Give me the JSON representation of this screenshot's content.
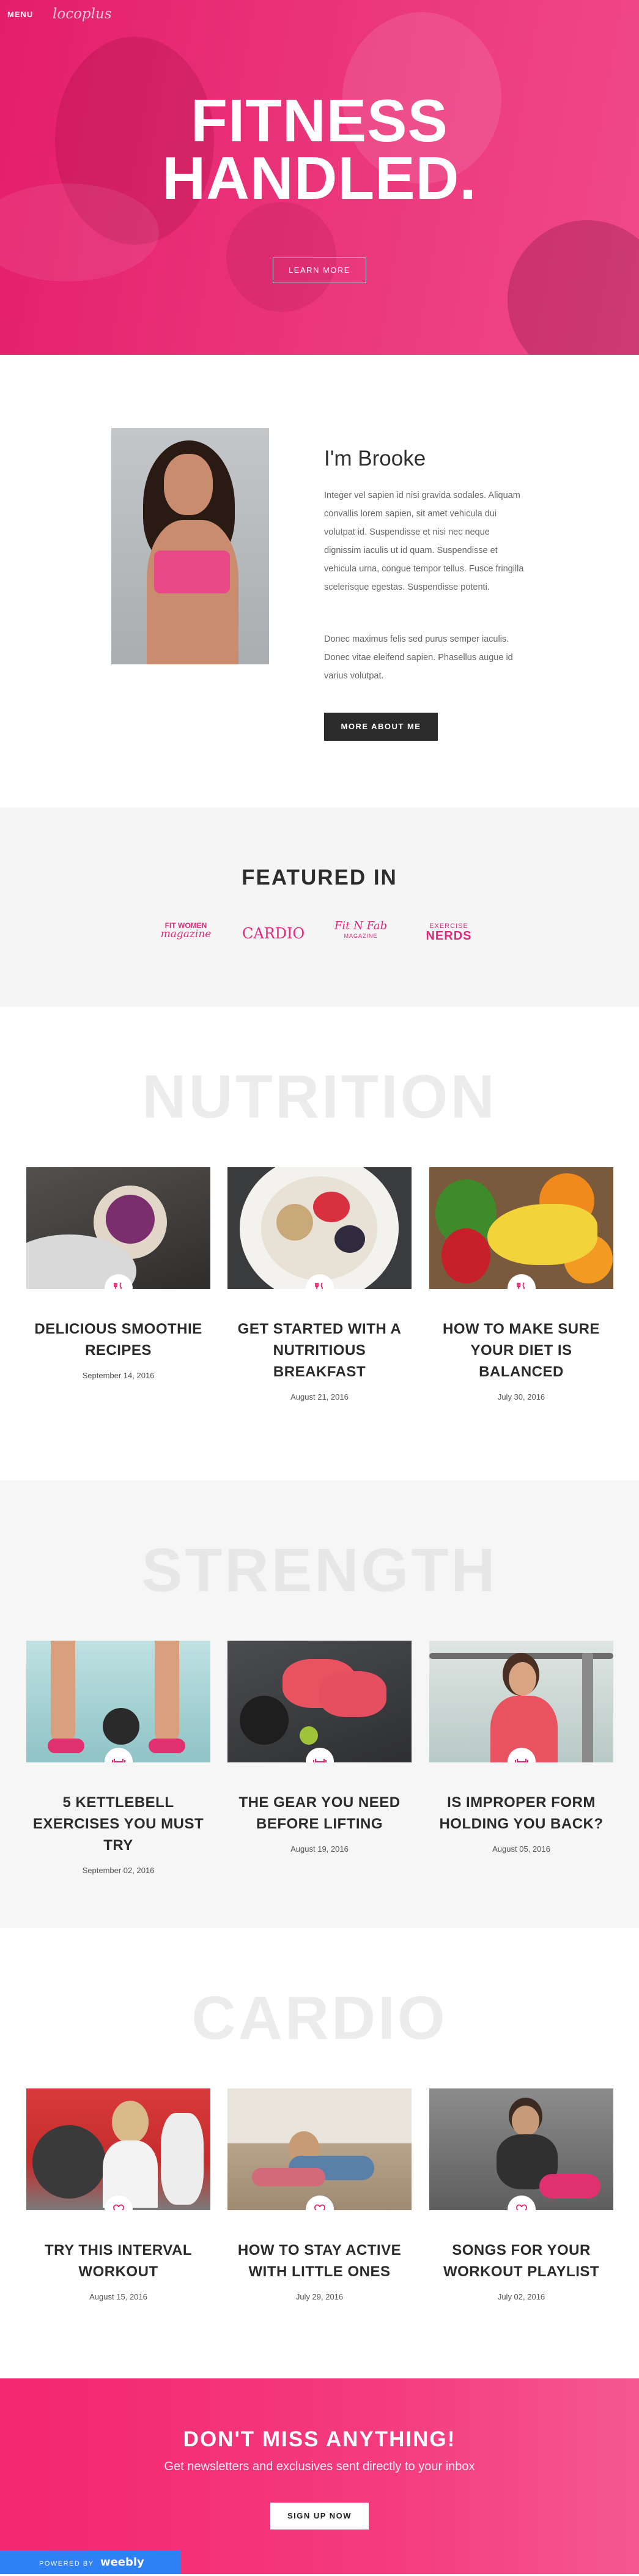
{
  "header": {
    "menu_label": "MENU",
    "logo_text": "locoplus"
  },
  "hero": {
    "title_line1": "FITNESS",
    "title_line2": "HANDLED.",
    "button_label": "LEARN MORE"
  },
  "about": {
    "title": "I'm Brooke",
    "paragraph1": "Integer vel sapien id nisi gravida sodales. Aliquam convallis lorem sapien, sit amet vehicula dui volutpat id. Suspendisse et nisi nec neque dignissim iaculis ut id quam. Suspendisse et vehicula urna, congue tempor tellus. Fusce fringilla scelerisque egestas. Suspendisse potenti.",
    "paragraph2": "Donec maximus felis sed purus semper iaculis. Donec vitae eleifend sapien. Phasellus augue id varius volutpat.",
    "button_label": "MORE ABOUT ME"
  },
  "featured": {
    "title": "FEATURED IN",
    "logos": {
      "fit_women_line1": "FIT WOMEN",
      "fit_women_line2": "magazine",
      "cardio": "CARDIO",
      "fit_n_fab": "Fit N Fab",
      "fit_n_fab_sub": "MAGAZINE",
      "exercise_line1": "EXERCISE",
      "exercise_line2": "NERDS"
    }
  },
  "sections": {
    "nutrition": {
      "heading": "NUTRITION",
      "posts": [
        {
          "title": "DELICIOUS SMOOTHIE RECIPES",
          "date": "September 14, 2016"
        },
        {
          "title": "GET STARTED WITH A NUTRITIOUS BREAKFAST",
          "date": "August 21, 2016"
        },
        {
          "title": "HOW TO MAKE SURE YOUR DIET IS BALANCED",
          "date": "July 30, 2016"
        }
      ]
    },
    "strength": {
      "heading": "STRENGTH",
      "posts": [
        {
          "title": "5 KETTLEBELL EXERCISES YOU MUST TRY",
          "date": "September 02, 2016"
        },
        {
          "title": "THE GEAR YOU NEED BEFORE LIFTING",
          "date": "August 19, 2016"
        },
        {
          "title": "IS IMPROPER FORM HOLDING YOU BACK?",
          "date": "August 05, 2016"
        }
      ]
    },
    "cardio": {
      "heading": "CARDIO",
      "posts": [
        {
          "title": "TRY THIS INTERVAL WORKOUT",
          "date": "August 15, 2016"
        },
        {
          "title": "HOW TO STAY ACTIVE WITH LITTLE ONES",
          "date": "July 29, 2016"
        },
        {
          "title": "SONGS FOR YOUR WORKOUT PLAYLIST",
          "date": "July 02, 2016"
        }
      ]
    }
  },
  "newsletter": {
    "title": "DON'T MISS ANYTHING!",
    "subtitle": "Get newsletters and exclusives sent directly to your inbox",
    "button_label": "SIGN UP NOW"
  },
  "footer_badge": {
    "prefix": "POWERED BY",
    "brand": "weebly"
  },
  "colors": {
    "accent": "#e8246f",
    "dark": "#2b2b2b",
    "footer_blue": "#2f80f5"
  },
  "icons": {
    "nutrition": "fork-knife-icon",
    "strength": "dumbbell-icon",
    "cardio": "heart-icon"
  }
}
